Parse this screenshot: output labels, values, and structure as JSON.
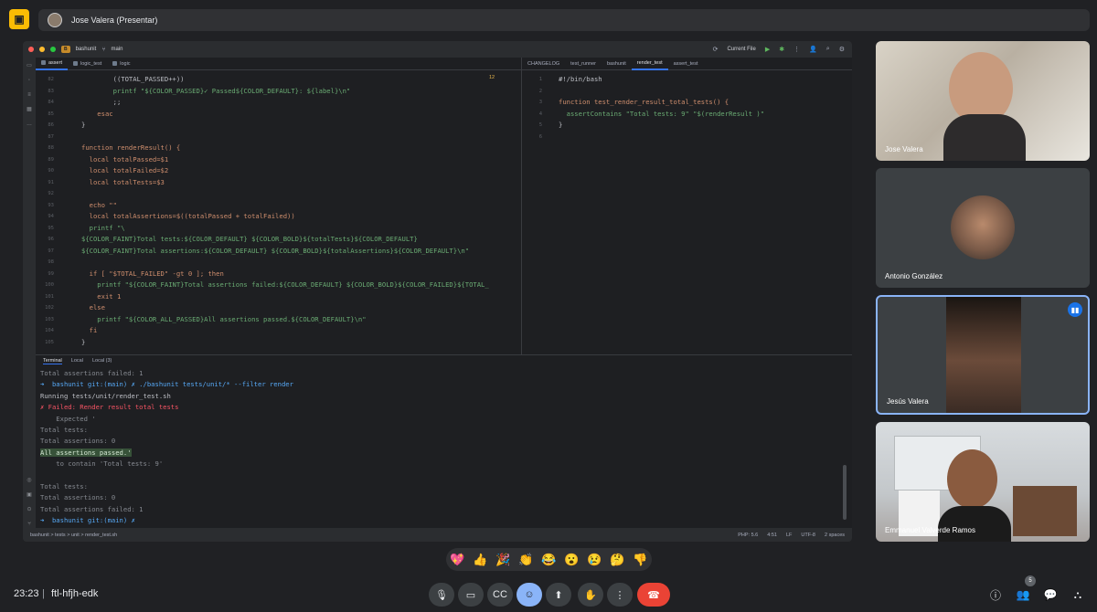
{
  "presenter": {
    "name": "Jose Valera (Presentar)"
  },
  "ide": {
    "project": "bashunit",
    "project_badge": "B",
    "branch": "main",
    "run_config": "Current File",
    "left_tabs": [
      "assert",
      "logic_test",
      "logic"
    ],
    "left_tab_count": "12",
    "right_tabs": [
      "CHANGELOG",
      "test_runner",
      "bashunit",
      "render_test",
      "assert_test"
    ],
    "left_lines": [
      {
        "num": "82",
        "text": "        ((TOTAL_PASSED++))"
      },
      {
        "num": "83",
        "text": "        printf \"${COLOR_PASSED}✓ Passed${COLOR_DEFAULT}: ${label}\\n\""
      },
      {
        "num": "84",
        "text": "        ;;"
      },
      {
        "num": "85",
        "text": "    esac"
      },
      {
        "num": "86",
        "text": "}"
      },
      {
        "num": "87",
        "text": ""
      },
      {
        "num": "88",
        "text": "function renderResult() {"
      },
      {
        "num": "89",
        "text": "  local totalPassed=$1"
      },
      {
        "num": "90",
        "text": "  local totalFailed=$2"
      },
      {
        "num": "91",
        "text": "  local totalTests=$3"
      },
      {
        "num": "92",
        "text": ""
      },
      {
        "num": "93",
        "text": "  echo \"\""
      },
      {
        "num": "94",
        "text": "  local totalAssertions=$((totalPassed + totalFailed))"
      },
      {
        "num": "95",
        "text": "  printf \"\\"
      },
      {
        "num": "96",
        "text": "${COLOR_FAINT}Total tests:${COLOR_DEFAULT} ${COLOR_BOLD}${totalTests}${COLOR_DEFAULT}"
      },
      {
        "num": "97",
        "text": "${COLOR_FAINT}Total assertions:${COLOR_DEFAULT} ${COLOR_BOLD}${totalAssertions}${COLOR_DEFAULT}\\n\""
      },
      {
        "num": "98",
        "text": ""
      },
      {
        "num": "99",
        "text": "  if [ \"$TOTAL_FAILED\" -gt 0 ]; then"
      },
      {
        "num": "100",
        "text": "    printf \"${COLOR_FAINT}Total assertions failed:${COLOR_DEFAULT} ${COLOR_BOLD}${COLOR_FAILED}${TOTAL_"
      },
      {
        "num": "101",
        "text": "    exit 1"
      },
      {
        "num": "102",
        "text": "  else"
      },
      {
        "num": "103",
        "text": "    printf \"${COLOR_ALL_PASSED}All assertions passed.${COLOR_DEFAULT}\\n\""
      },
      {
        "num": "104",
        "text": "  fi"
      },
      {
        "num": "105",
        "text": "}"
      }
    ],
    "right_lines": [
      {
        "num": "1",
        "text": "#!/bin/bash"
      },
      {
        "num": "2",
        "text": ""
      },
      {
        "num": "3",
        "text": "function test_render_result_total_tests() {"
      },
      {
        "num": "4",
        "text": "  assertContains \"Total tests: 9\" \"$(renderResult )\""
      },
      {
        "num": "5",
        "text": "}"
      },
      {
        "num": "6",
        "text": ""
      }
    ],
    "terminal": {
      "tabs": [
        "Terminal",
        "Local",
        "Local (3)"
      ],
      "lines": [
        "Total assertions failed: 1",
        "➜  bashunit git:(main) ✗ ./bashunit tests/unit/* --filter render",
        "Running tests/unit/render_test.sh",
        "✗ Failed: Render result total tests",
        "    Expected '",
        "Total tests:",
        "Total assertions: 0",
        "All assertions passed.'",
        "    to contain 'Total tests: 9'",
        "",
        "Total tests:",
        "Total assertions: 0",
        "Total assertions failed: 1",
        "➜  bashunit git:(main) ✗ "
      ]
    },
    "status": {
      "breadcrumb": "bashunit  >  tests  >  unit  >  render_test.sh",
      "php": "PHP: 5.6",
      "pos": "4:51",
      "eol": "LF",
      "enc": "UTF-8",
      "indent": "2 spaces"
    }
  },
  "participants": [
    {
      "name": "Jose Valera"
    },
    {
      "name": "Antonio González"
    },
    {
      "name": "Jesús Valera"
    },
    {
      "name": "Emmanuel Valverde Ramos"
    }
  ],
  "reactions": [
    "💖",
    "👍",
    "🎉",
    "👏",
    "😂",
    "😮",
    "😢",
    "🤔",
    "👎"
  ],
  "meeting": {
    "time": "23:23",
    "code": "ftl-hfjh-edk",
    "people_count": "5"
  },
  "icons": {
    "present": "present-to-all-off-icon",
    "mic": "mic-icon",
    "camera": "videocam-icon",
    "captions": "closed-caption-icon",
    "emoji": "emoji-icon",
    "present_screen": "present-screen-icon",
    "hand": "raise-hand-icon",
    "more": "more-vert-icon",
    "end": "call-end-icon",
    "info": "info-icon",
    "people": "people-icon",
    "chat": "chat-icon",
    "activities": "activities-icon"
  }
}
